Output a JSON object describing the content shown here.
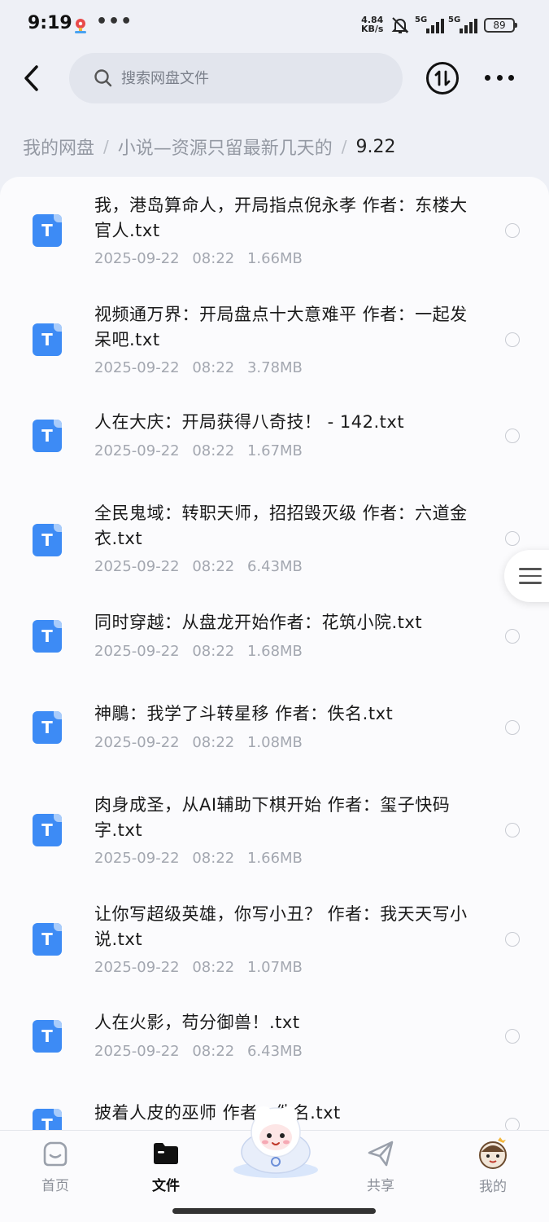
{
  "status_bar": {
    "time": "9:19",
    "dots": "•••",
    "net_speed_value": "4.84",
    "net_speed_unit": "KB/s",
    "sim1": "5G",
    "sim2": "5G",
    "battery": "89"
  },
  "header": {
    "search_placeholder": "搜索网盘文件"
  },
  "breadcrumb": {
    "root": "我的网盘",
    "folder": "小说—资源只留最新几天的",
    "current": "9.22",
    "separator": "/"
  },
  "files": [
    {
      "icon": "T",
      "name": "我，港岛算命人，开局指点倪永孝 作者：东楼大官人.txt",
      "date": "2025-09-22",
      "time": "08:22",
      "size": "1.66MB"
    },
    {
      "icon": "T",
      "name": "视频通万界：开局盘点十大意难平 作者：一起发呆吧.txt",
      "date": "2025-09-22",
      "time": "08:22",
      "size": "3.78MB"
    },
    {
      "icon": "T",
      "name": "人在大庆：开局获得八奇技！ - 142.txt",
      "date": "2025-09-22",
      "time": "08:22",
      "size": "1.67MB"
    },
    {
      "icon": "T",
      "name": "全民鬼域：转职天师，招招毁灭级 作者：六道金衣.txt",
      "date": "2025-09-22",
      "time": "08:22",
      "size": "6.43MB"
    },
    {
      "icon": "T",
      "name": "同时穿越：从盘龙开始作者：花筑小院.txt",
      "date": "2025-09-22",
      "time": "08:22",
      "size": "1.68MB"
    },
    {
      "icon": "T",
      "name": "神鵰：我学了斗转星移 作者：佚名.txt",
      "date": "2025-09-22",
      "time": "08:22",
      "size": "1.08MB"
    },
    {
      "icon": "T",
      "name": "肉身成圣，从AI辅助下棋开始 作者：玺子快码字.txt",
      "date": "2025-09-22",
      "time": "08:22",
      "size": "1.66MB"
    },
    {
      "icon": "T",
      "name": "让你写超级英雄，你写小丑？ 作者：我天天写小说.txt",
      "date": "2025-09-22",
      "time": "08:22",
      "size": "1.07MB"
    },
    {
      "icon": "T",
      "name": "人在火影，苟分御兽！.txt",
      "date": "2025-09-22",
      "time": "08:22",
      "size": "6.43MB"
    },
    {
      "icon": "T",
      "name": "披着人皮的巫师 作者：佚名.txt",
      "date": "",
      "time": "",
      "size": ""
    }
  ],
  "tabs": [
    {
      "label": "首页",
      "icon": "home-icon"
    },
    {
      "label": "文件",
      "icon": "folder-icon",
      "active": true
    },
    {
      "label": "共享",
      "icon": "share-icon"
    },
    {
      "label": "我的",
      "icon": "avatar-icon"
    }
  ],
  "colors": {
    "accent": "#3d8bf5",
    "background": "#eef0f6",
    "panel": "#fbfbfd"
  }
}
